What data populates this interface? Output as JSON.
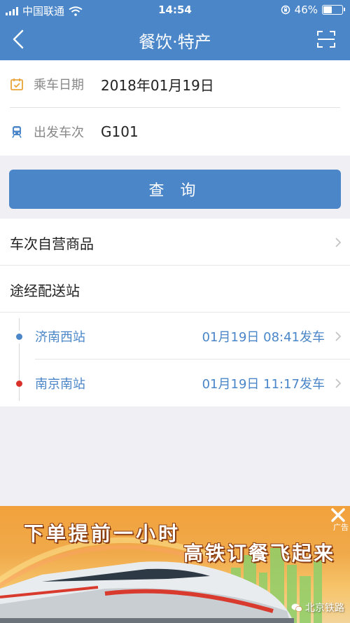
{
  "status_bar": {
    "carrier": "中国联通",
    "time": "14:54",
    "battery": "46%",
    "battery_level": 0.46
  },
  "nav": {
    "title": "餐饮·特产",
    "back_icon": "chevron-left-icon",
    "scan_icon": "scan-icon"
  },
  "form": {
    "date_label": "乘车日期",
    "date_value": "2018年01月19日",
    "train_label": "出发车次",
    "train_value": "G101"
  },
  "query_button": "查 询",
  "list": {
    "self_products": "车次自营商品",
    "stations_header": "途经配送站",
    "stations": [
      {
        "name": "济南西站",
        "time": "01月19日 08:41发车",
        "dot_color": "#4a86c8"
      },
      {
        "name": "南京南站",
        "time": "01月19日 11:17发车",
        "dot_color": "#d9302a"
      }
    ]
  },
  "ad": {
    "line1": "下单提前一小时",
    "line2": "高铁订餐飞起来",
    "tag": "广告",
    "watermark": "北京铁路"
  },
  "colors": {
    "primary": "#4a86c8",
    "background": "#efeff4"
  }
}
